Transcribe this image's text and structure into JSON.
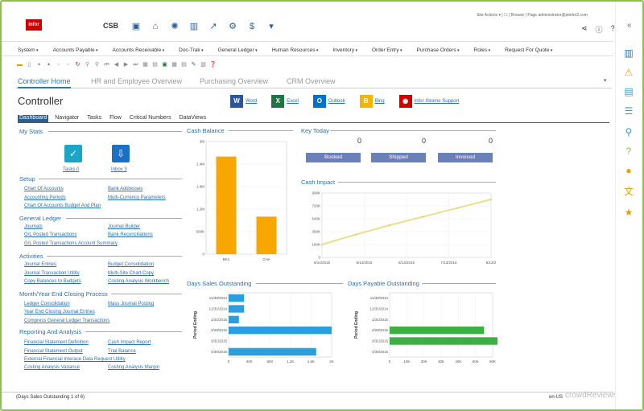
{
  "app": {
    "logo": "infor",
    "company": "CSB",
    "top_links": "Site Actions ▾  |  ☐  |  Browse  |  Page     administrator@ptinfor2.com"
  },
  "menu": [
    "System",
    "Accounts Payable",
    "Accounts Receivable",
    "Doc-Trak",
    "General Ledger",
    "Human Resources",
    "Inventory",
    "Order Entry",
    "Purchase Orders",
    "Roles",
    "Request For Quote"
  ],
  "tabs": [
    "Controller Home",
    "HR and Employee Overview",
    "Purchasing Overview",
    "CRM Overview"
  ],
  "page_title": "Controller",
  "apps": [
    {
      "label": "Word",
      "letter": "W",
      "color": "#2b579a"
    },
    {
      "label": "Excel",
      "letter": "X",
      "color": "#217346"
    },
    {
      "label": "Outlook",
      "letter": "O",
      "color": "#0072c6"
    },
    {
      "label": "Bing",
      "letter": "B",
      "color": "#f4b400"
    },
    {
      "label": "Infor Xtreme Support",
      "letter": "◉",
      "color": "#c00"
    }
  ],
  "subtabs": [
    "Dashboard",
    "Navigator",
    "Tasks",
    "Flow",
    "Critical Numbers",
    "DataViews"
  ],
  "my_stats": {
    "title": "My Stats",
    "tasks": "Tasks  0",
    "inbox": "Inbox  3"
  },
  "setup": {
    "title": "Setup",
    "links": [
      "Chart Of Accounts",
      "Bank Addresses",
      "Accounting Periods",
      "Multi-Currency Parameters",
      "Chart Of Accounts Budget And Plan"
    ]
  },
  "general_ledger": {
    "title": "General Ledger",
    "links": [
      "Journals",
      "Journal Builder",
      "G/L Posted Transactions",
      "Bank Reconciliations",
      "G/L Posted Transactions Account Summary"
    ]
  },
  "activities": {
    "title": "Activities",
    "links": [
      "Journal Entries",
      "Budget Consolidation",
      "Journal Transaction Utility",
      "Multi-Site Chart Copy",
      "Copy Balances to Budgets",
      "Costing Analysis Workbench"
    ]
  },
  "month_end": {
    "title": "Month/Year End Closing Process",
    "links": [
      "Ledger Consolidation",
      "Mass Journal Posting",
      "Year End Closing Journal Entries",
      "Compress General Ledger Transactions"
    ]
  },
  "reporting": {
    "title": "Reporting And Analysis",
    "links": [
      "Financial Statement Definition",
      "Cash Impact Report",
      "Financial Statement Output",
      "Trial Balance",
      "External Financial Interace Data Request Utility",
      "Costing Analysis Variance",
      "Costing Analysis Margin"
    ]
  },
  "cash_balance": {
    "title": "Cash Balance"
  },
  "key_today": {
    "title": "Key Today",
    "items": [
      {
        "label": "Booked",
        "value": "0"
      },
      {
        "label": "Shipped",
        "value": "0"
      },
      {
        "label": "Invoiced",
        "value": "0"
      }
    ]
  },
  "cash_impact": {
    "title": "Cash Impact"
  },
  "dso": {
    "title": "Days Sales Outstanding"
  },
  "dpo": {
    "title": "Days Payable Outstanding"
  },
  "status": "(Days Sales Outstanding 1 of 6)",
  "status_right": "en-US",
  "watermark": "crowdReviews",
  "chart_data": [
    {
      "type": "bar",
      "title": "Cash Balance",
      "categories": [
        "BK1",
        "CHA"
      ],
      "values": [
        2.6,
        1.0
      ],
      "ylim": [
        0,
        3
      ],
      "yticks": [
        "0",
        "600K",
        "1.2M",
        "1.8M",
        "2.4M",
        "3M"
      ],
      "color": "#f7a700"
    },
    {
      "type": "line",
      "title": "Cash Impact",
      "x": [
        "6/14/2015",
        "6/14/2015",
        "6/13/2015",
        "7/13/2015",
        "8/12/2"
      ],
      "values": [
        180,
        320,
        450,
        570,
        690,
        810
      ],
      "ylim": [
        0,
        900
      ],
      "yticks": [
        "0",
        "180K",
        "360K",
        "540K",
        "720K",
        "900K"
      ],
      "color": "#e8e08a"
    },
    {
      "type": "bar",
      "orientation": "horizontal",
      "title": "Days Sales Outstanding",
      "categories": [
        "11/30/2014",
        "12/31/2014",
        "1/31/2015",
        "2/28/2015",
        "3/31/2015",
        "4/30/2015"
      ],
      "values": [
        300,
        300,
        200,
        2000,
        0,
        1700
      ],
      "xlim": [
        0,
        2000
      ],
      "xticks": [
        "0",
        "400",
        "800",
        "1.2K",
        "1.6K",
        "2K"
      ],
      "ylabel": "Period Ending",
      "color": "#2a9fe0"
    },
    {
      "type": "bar",
      "orientation": "horizontal",
      "title": "Days Payable Outstanding",
      "categories": [
        "11/30/2014",
        "12/31/2014",
        "1/31/2015",
        "2/28/2015",
        "3/31/2015",
        "4/30/2015"
      ],
      "values": [
        0,
        0,
        0,
        55000,
        65000,
        0
      ],
      "xlim": [
        0,
        60000
      ],
      "xticks": [
        "0",
        "10K",
        "20K",
        "30K",
        "40K",
        "50K",
        "60K"
      ],
      "ylabel": "Period Ending",
      "color": "#3cb043"
    }
  ]
}
